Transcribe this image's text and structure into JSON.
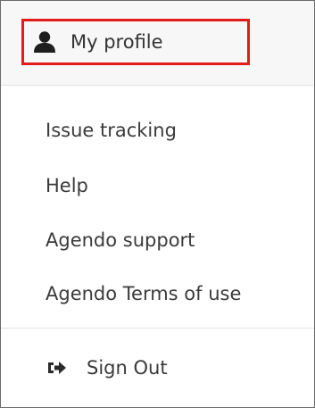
{
  "menu": {
    "profile": {
      "label": "My profile",
      "icon": "user-icon"
    },
    "items": [
      {
        "label": "Issue tracking"
      },
      {
        "label": "Help"
      },
      {
        "label": "Agendo support"
      },
      {
        "label": "Agendo Terms of use"
      }
    ],
    "signout": {
      "label": "Sign Out",
      "icon": "sign-out-icon"
    }
  },
  "colors": {
    "highlight": "#e21b1b",
    "header_bg": "#f7f7f7",
    "text": "#333333",
    "border": "#6b6b6b",
    "divider": "#e4e4e4"
  }
}
